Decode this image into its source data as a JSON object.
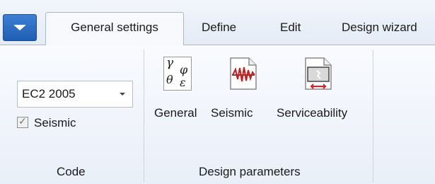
{
  "app_button": {
    "icon": "dropdown-triangle-icon"
  },
  "tabs": [
    {
      "label": "General settings",
      "active": true
    },
    {
      "label": "Define",
      "active": false
    },
    {
      "label": "Edit",
      "active": false
    },
    {
      "label": "Design wizard",
      "active": false
    }
  ],
  "code_group": {
    "label": "Code",
    "code_select": {
      "value": "EC2 2005"
    },
    "seismic_checkbox": {
      "label": "Seismic",
      "checked": true
    }
  },
  "design_group": {
    "label": "Design parameters",
    "buttons": [
      {
        "label": "General",
        "icon": "greek-symbols-document-icon",
        "symbols": [
          "γ",
          "φ",
          "θ",
          "ε"
        ]
      },
      {
        "label": "Seismic",
        "icon": "seismic-wave-icon"
      },
      {
        "label": "Serviceability",
        "icon": "serviceability-icon"
      }
    ]
  }
}
